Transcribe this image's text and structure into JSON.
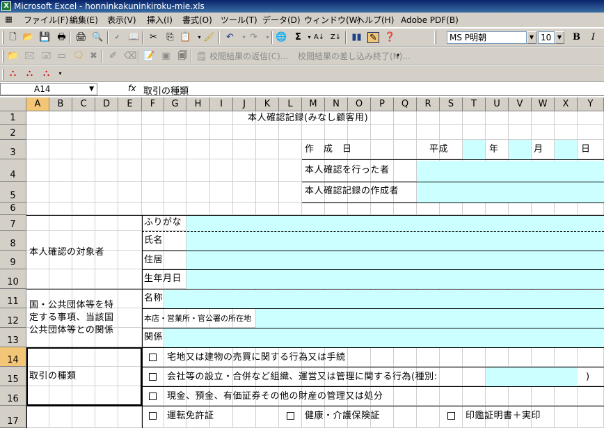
{
  "window": {
    "title": "Microsoft Excel - honninkakuninkiroku-mie.xls",
    "app_icon": "excel-icon"
  },
  "menu": [
    "ファイル(F)",
    "編集(E)",
    "表示(V)",
    "挿入(I)",
    "書式(O)",
    "ツール(T)",
    "データ(D)",
    "ウィンドウ(W)",
    "ヘルプ(H)",
    "Adobe PDF(B)"
  ],
  "toolbar": {
    "font_name": "MS P明朝",
    "font_size": "10",
    "bold": "B",
    "italic": "I",
    "sum": "Σ"
  },
  "reviewing_toolbar": {
    "reply": "校閲結果の返信(C)...",
    "end_review": "校閲結果の差し込み終了(N)..."
  },
  "formula_bar": {
    "name_box": "A14",
    "fx": "fx",
    "content": "取引の種類"
  },
  "columns": [
    "A",
    "B",
    "C",
    "D",
    "E",
    "F",
    "G",
    "H",
    "I",
    "J",
    "K",
    "L",
    "M",
    "N",
    "O",
    "P",
    "Q",
    "R",
    "S",
    "T",
    "U",
    "V",
    "W",
    "X",
    "Y"
  ],
  "rows": [
    "1",
    "2",
    "3",
    "4",
    "5",
    "6",
    "7",
    "8",
    "9",
    "10",
    "11",
    "12",
    "13",
    "14",
    "15",
    "16",
    "17"
  ],
  "active": {
    "column": "A",
    "row": "14"
  },
  "sheet": {
    "title": "本人確認記録(みなし顧客用)",
    "created_label": "作　成　日",
    "era": "平成",
    "year": "年",
    "month": "月",
    "day": "日",
    "confirmer_label": "本人確認を行った者",
    "recorder_label": "本人確認記録の作成者",
    "subject_label": "本人確認の対象者",
    "furigana": "ふりがな",
    "name": "氏名",
    "address": "住居",
    "birthdate": "生年月日",
    "org_label_1": "国・公共団体等を特",
    "org_label_2": "定する事項、当該国",
    "org_label_3": "公共団体等との関係",
    "org_name": "名称",
    "org_location": "本店・営業所・官公署の所在地",
    "relation": "関係",
    "transaction_label": "取引の種類",
    "tx_options": [
      "宅地又は建物の売買に関する行為又は手続",
      "会社等の設立・合併など組織、運営又は管理に関する行為(種別:",
      "現金、預金、有価証券その他の財産の管理又は処分"
    ],
    "tx_close": ")",
    "id_options": [
      "運転免許証",
      "健康・介護保険証",
      "印鑑証明書＋実印"
    ]
  }
}
